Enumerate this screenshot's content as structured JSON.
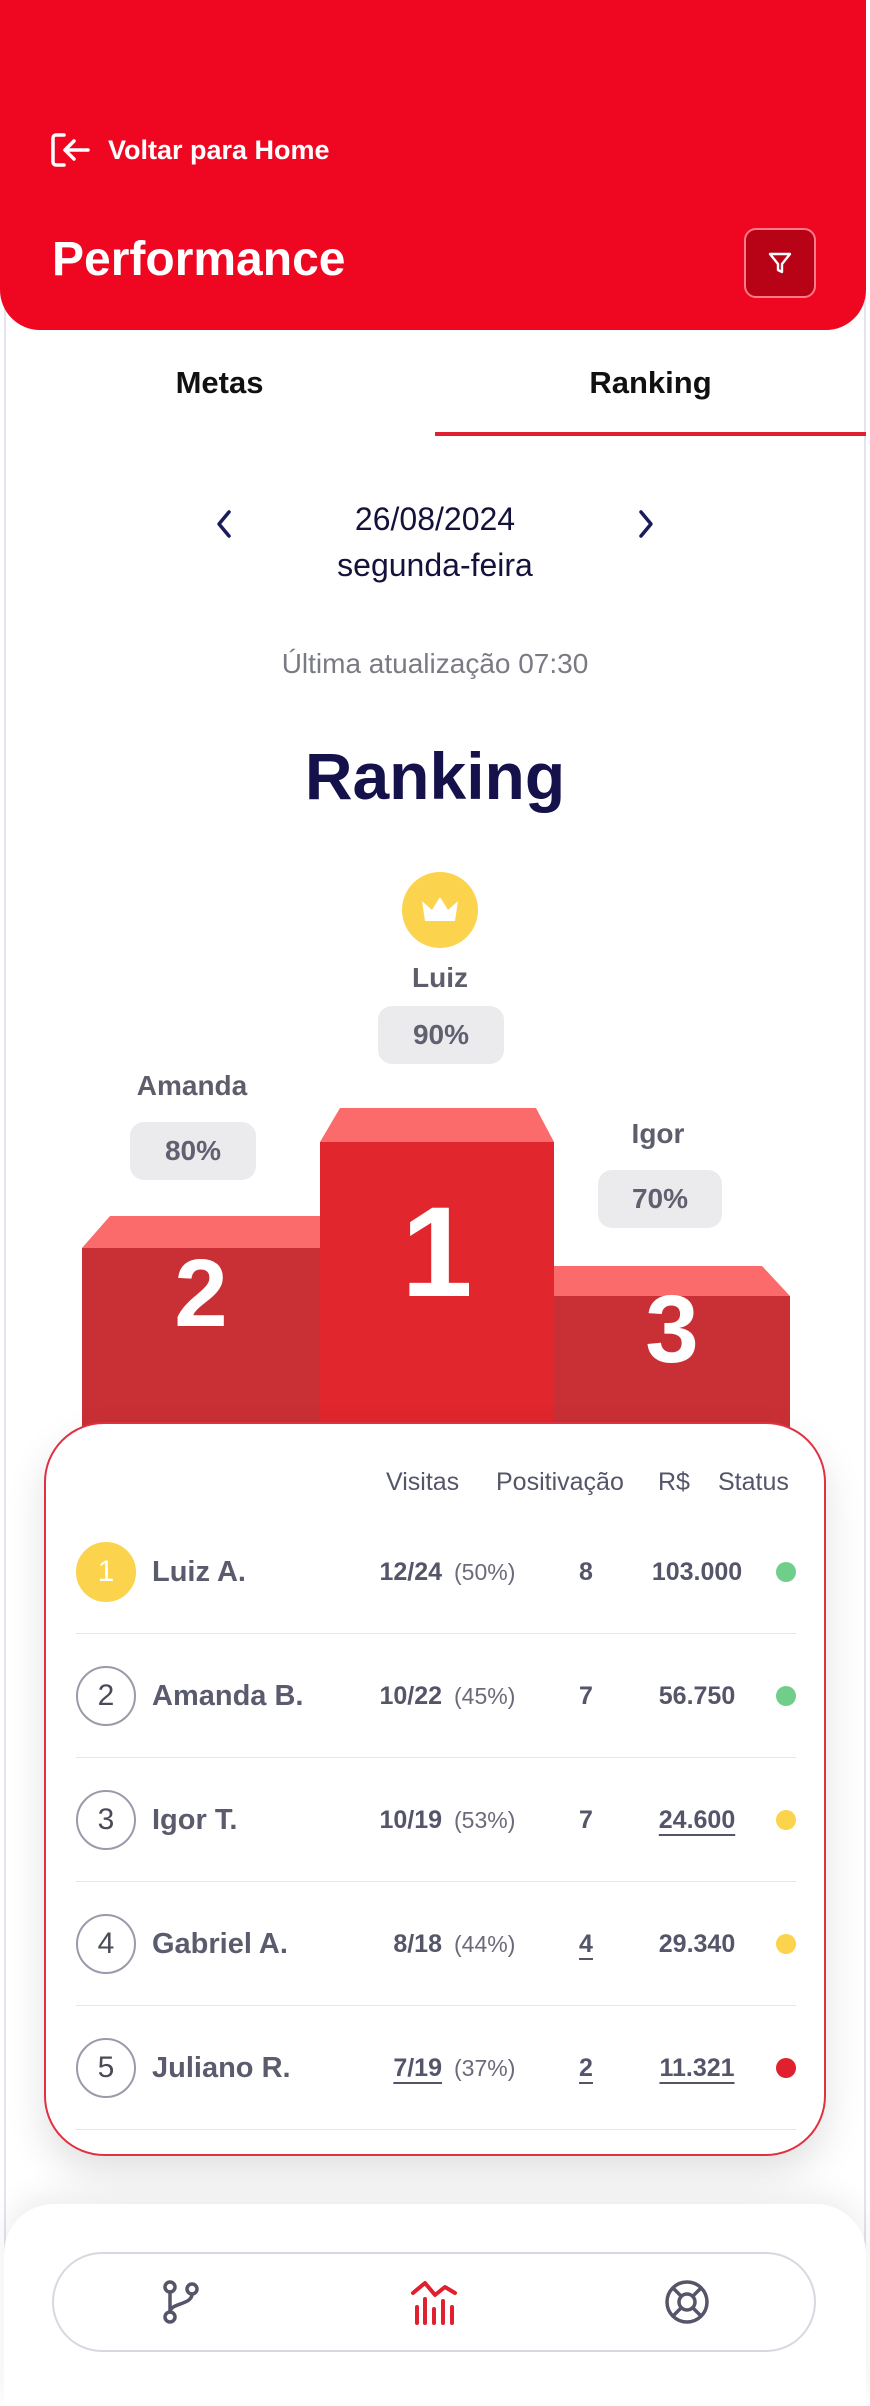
{
  "header": {
    "back_label": "Voltar para Home",
    "title": "Performance",
    "filter_icon": "filter-icon"
  },
  "tabs": [
    {
      "label": "Metas",
      "active": false
    },
    {
      "label": "Ranking",
      "active": true
    }
  ],
  "date_nav": {
    "date": "26/08/2024",
    "weekday": "segunda-feira"
  },
  "updated_text": "Última atualização 07:30",
  "ranking_title": "Ranking",
  "podium": {
    "first": {
      "position": "1",
      "name": "Luiz",
      "percent": "90%"
    },
    "second": {
      "position": "2",
      "name": "Amanda",
      "percent": "80%"
    },
    "third": {
      "position": "3",
      "name": "Igor",
      "percent": "70%"
    }
  },
  "table": {
    "headers": {
      "visits": "Visitas",
      "positivation": "Positivação",
      "money": "R$",
      "status": "Status"
    },
    "rows": [
      {
        "rank": "1",
        "name": "Luiz A.",
        "visits": "12/24",
        "visits_pct": "(50%)",
        "positivation": "8",
        "money": "103.000",
        "status": "ok"
      },
      {
        "rank": "2",
        "name": "Amanda B.",
        "visits": "10/22",
        "visits_pct": "(45%)",
        "positivation": "7",
        "money": "56.750",
        "status": "ok"
      },
      {
        "rank": "3",
        "name": "Igor T.",
        "visits": "10/19",
        "visits_pct": "(53%)",
        "positivation": "7",
        "money": "24.600",
        "status": "warning"
      },
      {
        "rank": "4",
        "name": "Gabriel A.",
        "visits": "8/18",
        "visits_pct": "(44%)",
        "positivation": "4",
        "money": "29.340",
        "status": "warning"
      },
      {
        "rank": "5",
        "name": "Juliano R.",
        "visits": "7/19",
        "visits_pct": "(37%)",
        "positivation": "2",
        "money": "11.321",
        "status": "bad"
      }
    ]
  },
  "colors": {
    "brand": "#ef0722",
    "status_ok": "#6fcf8a",
    "status_warning": "#fcd34d",
    "status_bad": "#e0202e",
    "gold": "#fcd34d"
  },
  "bottom_nav": [
    {
      "icon": "git-branch-icon",
      "active": false
    },
    {
      "icon": "chart-icon",
      "active": true
    },
    {
      "icon": "lifebuoy-icon",
      "active": false
    }
  ]
}
